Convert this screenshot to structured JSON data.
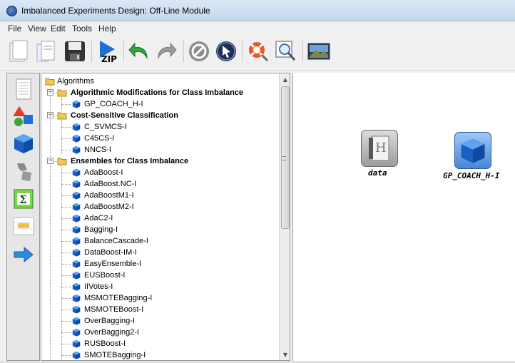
{
  "window": {
    "title": "Imbalanced Experiments Design: Off-Line Module"
  },
  "menu": [
    "File",
    "View",
    "Edit",
    "Tools",
    "Help"
  ],
  "toolbar": {
    "buttons": [
      "new-document",
      "open-document",
      "save",
      "zip",
      "undo",
      "redo",
      "stop",
      "select",
      "help",
      "zoom",
      "image"
    ],
    "zip_label": "ZIP"
  },
  "palette": [
    "dataset",
    "multiple-classifiers",
    "method",
    "preprocess",
    "statistical-test",
    "results-table",
    "connect-arrow"
  ],
  "tree": {
    "root": "Algorithms",
    "categories": [
      {
        "label": "Algorithmic Modifications for Class Imbalance",
        "items": [
          "GP_COACH_H-I"
        ]
      },
      {
        "label": "Cost-Sensitive Classification",
        "items": [
          "C_SVMCS-I",
          "C45CS-I",
          "NNCS-I"
        ]
      },
      {
        "label": "Ensembles for Class Imbalance",
        "items": [
          "AdaBoost-I",
          "AdaBoost.NC-I",
          "AdaBoostM1-I",
          "AdaBoostM2-I",
          "AdaC2-I",
          "Bagging-I",
          "BalanceCascade-I",
          "DataBoost-IM-I",
          "EasyEnsemble-I",
          "EUSBoost-I",
          "IIVotes-I",
          "MSMOTEBagging-I",
          "MSMOTEBoost-I",
          "OverBagging-I",
          "OverBagging2-I",
          "RUSBoost-I",
          "SMOTEBagging-I"
        ]
      }
    ]
  },
  "canvas": {
    "nodes": [
      {
        "label": "data",
        "kind": "dataset"
      },
      {
        "label": "GP_COACH_H-I",
        "kind": "method"
      }
    ]
  },
  "colors": {
    "method_blue": "#1e6fd6",
    "folder_yellow": "#f0c94a",
    "canvas_bg": "#ffffff"
  }
}
